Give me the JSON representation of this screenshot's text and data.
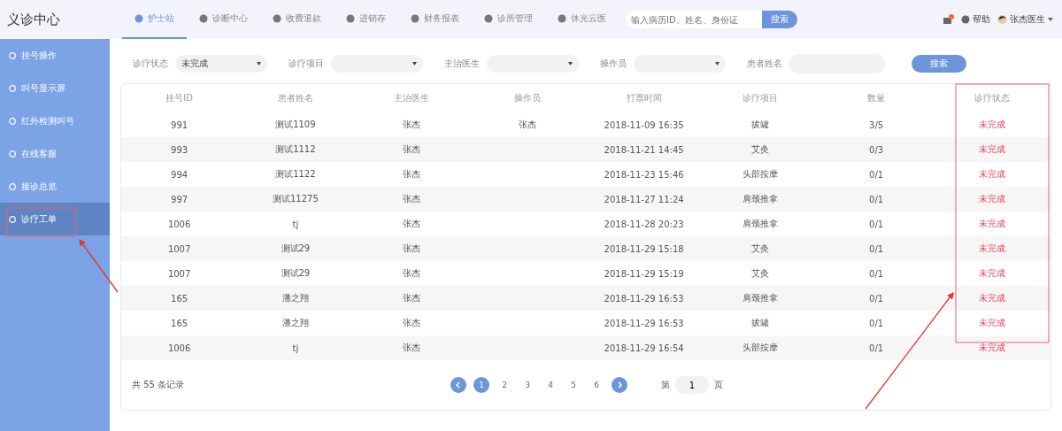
{
  "header": {
    "logo": "义诊中心",
    "nav": [
      {
        "label": "护士站",
        "selected": true
      },
      {
        "label": "诊断中心",
        "selected": false
      },
      {
        "label": "收费退款",
        "selected": false
      },
      {
        "label": "进销存",
        "selected": false
      },
      {
        "label": "财务报表",
        "selected": false
      },
      {
        "label": "诊所管理",
        "selected": false
      },
      {
        "label": "休光云医",
        "selected": false
      }
    ],
    "search": {
      "placeholder": "输入病历ID、姓名、身份证",
      "button": "搜索"
    },
    "help": "帮助",
    "user": "张杰医生"
  },
  "sidebar": {
    "items": [
      {
        "label": "挂号操作",
        "selected": false
      },
      {
        "label": "叫号显示屏",
        "selected": false
      },
      {
        "label": "红外检测叫号",
        "selected": false
      },
      {
        "label": "在线客服",
        "selected": false
      },
      {
        "label": "接诊总览",
        "selected": false
      },
      {
        "label": "诊疗工单",
        "selected": true
      }
    ]
  },
  "filters": [
    {
      "label": "诊疗状态",
      "value": "未完成",
      "kind": "select"
    },
    {
      "label": "诊疗项目",
      "kind": "select"
    },
    {
      "label": "主治医生",
      "kind": "select"
    },
    {
      "label": "操作员",
      "kind": "select"
    },
    {
      "label": "患者姓名",
      "kind": "input"
    }
  ],
  "filter_button": "搜索",
  "table": {
    "columns": [
      "挂号ID",
      "患者姓名",
      "主治医生",
      "操作员",
      "打票时间",
      "诊疗项目",
      "数量",
      "诊疗状态"
    ],
    "rows": [
      [
        "991",
        "测试1109",
        "张杰",
        "张杰",
        "2018-11-09 16:35",
        "拔罐",
        "3/5",
        "未完成"
      ],
      [
        "993",
        "测试1112",
        "张杰",
        "",
        "2018-11-21 14:45",
        "艾灸",
        "0/3",
        "未完成"
      ],
      [
        "994",
        "测试1122",
        "张杰",
        "",
        "2018-11-23 15:46",
        "头部按摩",
        "0/1",
        "未完成"
      ],
      [
        "997",
        "测试11275",
        "张杰",
        "",
        "2018-11-27 11:24",
        "肩颈推拿",
        "0/1",
        "未完成"
      ],
      [
        "1006",
        "tj",
        "张杰",
        "",
        "2018-11-28 20:23",
        "肩颈推拿",
        "0/1",
        "未完成"
      ],
      [
        "1007",
        "测试29",
        "张杰",
        "",
        "2018-11-29 15:18",
        "艾灸",
        "0/1",
        "未完成"
      ],
      [
        "1007",
        "测试29",
        "张杰",
        "",
        "2018-11-29 15:19",
        "艾灸",
        "0/1",
        "未完成"
      ],
      [
        "165",
        "潘之翔",
        "张杰",
        "",
        "2018-11-29 16:53",
        "肩颈推拿",
        "0/1",
        "未完成"
      ],
      [
        "165",
        "潘之翔",
        "张杰",
        "",
        "2018-11-29 16:53",
        "拔罐",
        "0/1",
        "未完成"
      ],
      [
        "1006",
        "tj",
        "张杰",
        "",
        "2018-11-29 16:54",
        "头部按摩",
        "0/1",
        "未完成"
      ]
    ]
  },
  "footer": {
    "total": "共 55 条记录",
    "pages": [
      {
        "label": "1",
        "selected": true
      },
      {
        "label": "2",
        "selected": false
      },
      {
        "label": "3",
        "selected": false
      },
      {
        "label": "4",
        "selected": false
      },
      {
        "label": "5",
        "selected": false
      },
      {
        "label": "6",
        "selected": false
      }
    ],
    "goto_prefix": "第",
    "goto_value": "1",
    "goto_suffix": "页"
  }
}
